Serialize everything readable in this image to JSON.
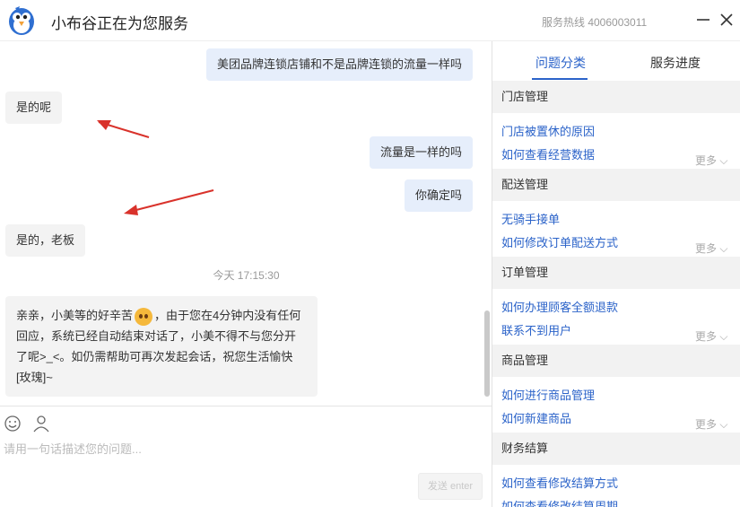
{
  "header": {
    "title": "小布谷正在为您服务",
    "hotline": "服务热线 4006003011"
  },
  "messages": [
    {
      "side": "right",
      "text": "美团品牌连锁店铺和不是品牌连锁的流量一样吗"
    },
    {
      "side": "left",
      "text": "是的呢"
    },
    {
      "side": "right",
      "text": "流量是一样的吗"
    },
    {
      "side": "right",
      "text": "你确定吗"
    },
    {
      "side": "left",
      "text": "是的，老板"
    }
  ],
  "timestamp": "今天 17:15:30",
  "long_message": {
    "part1": "亲亲，小美等的好辛苦",
    "part2": "，由于您在4分钟内没有任何回应，系统已经自动结束对话了，小美不得不与您分开了呢>_<。如仍需帮助可再次发起会话，祝您生活愉快[玫瑰]~"
  },
  "composer": {
    "placeholder": "请用一句话描述您的问题...",
    "send_label": "发送 enter"
  },
  "sidebar": {
    "tabs": [
      "问题分类",
      "服务进度"
    ],
    "more_label": "更多",
    "categories": [
      {
        "name": "门店管理",
        "links": [
          "门店被置休的原因",
          "如何查看经营数据"
        ]
      },
      {
        "name": "配送管理",
        "links": [
          "无骑手接单",
          "如何修改订单配送方式"
        ]
      },
      {
        "name": "订单管理",
        "links": [
          "如何办理顾客全额退款",
          "联系不到用户"
        ]
      },
      {
        "name": "商品管理",
        "links": [
          "如何进行商品管理",
          "如何新建商品"
        ]
      },
      {
        "name": "财务结算",
        "links": [
          "如何查看修改结算方式",
          "如何查看修改结算周期"
        ]
      }
    ]
  },
  "colors": {
    "accent": "#2b63c9",
    "bubble_right": "#e6eefb",
    "bubble_left": "#f3f3f3",
    "annotation_arrow": "#d9322b"
  }
}
